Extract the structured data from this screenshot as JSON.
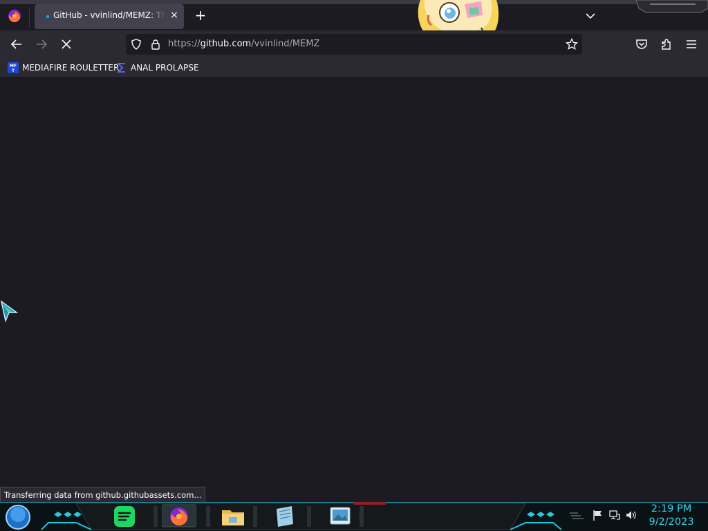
{
  "browser": {
    "tab": {
      "title": "GitHub - vvinlind/MEMZ: The MEMZ trojan",
      "close_label": "×"
    },
    "new_tab_label": "+",
    "url": {
      "prefix": "https://",
      "host": "github.com",
      "path": "/vvinlind/MEMZ"
    },
    "bookmarks": [
      {
        "label": "MEDIAFIRE ROULETTER",
        "icon": "mft-icon"
      },
      {
        "label": "ANAL PROLAPSE",
        "icon": "sigma-icon"
      }
    ],
    "status_text": "Transferring data from github.githubassets.com..."
  },
  "taskbar": {
    "apps": [
      "spotify-icon",
      "firefox-icon",
      "file-explorer-icon",
      "notepad-icon",
      "photos-icon"
    ],
    "clock": {
      "time": "2:19 PM",
      "date": "9/2/2023"
    }
  },
  "colors": {
    "chrome": "#2b2a33",
    "content": "#1c1b22",
    "accent": "#00b3f4",
    "taskbar_accent": "#34d6e8"
  }
}
